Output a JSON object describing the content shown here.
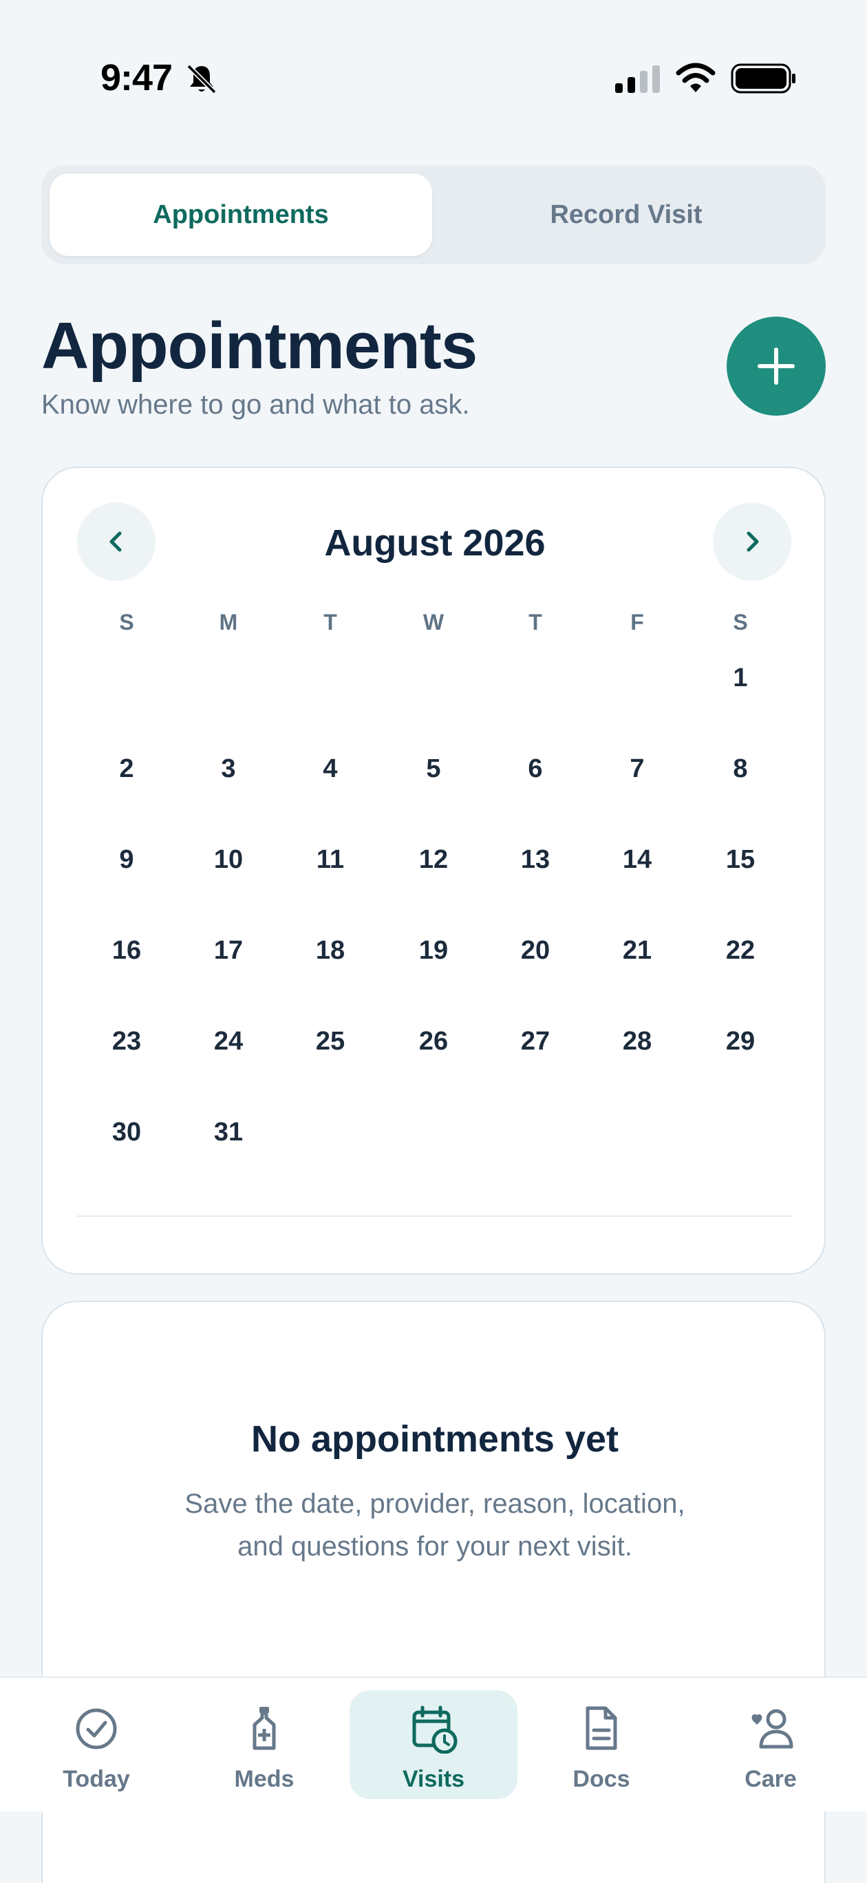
{
  "status_bar": {
    "time": "9:47"
  },
  "segmented": {
    "active_label": "Appointments",
    "inactive_label": "Record Visit"
  },
  "header": {
    "title": "Appointments",
    "subtitle": "Know where to go and what to ask."
  },
  "calendar": {
    "month_label": "August 2026",
    "prev_icon": "chevron-left-icon",
    "next_icon": "chevron-right-icon",
    "weekdays": [
      "S",
      "M",
      "T",
      "W",
      "T",
      "F",
      "S"
    ],
    "first_weekday_index": 6,
    "days": [
      "1",
      "2",
      "3",
      "4",
      "5",
      "6",
      "7",
      "8",
      "9",
      "10",
      "11",
      "12",
      "13",
      "14",
      "15",
      "16",
      "17",
      "18",
      "19",
      "20",
      "21",
      "22",
      "23",
      "24",
      "25",
      "26",
      "27",
      "28",
      "29",
      "30",
      "31"
    ]
  },
  "empty_state": {
    "title": "No appointments yet",
    "desc_line1": "Save the date, provider, reason, location,",
    "desc_line2": "and questions for your next visit."
  },
  "tab_bar": {
    "tabs": [
      {
        "label": "Today",
        "icon": "check-circle-icon"
      },
      {
        "label": "Meds",
        "icon": "medicine-bottle-icon"
      },
      {
        "label": "Visits",
        "icon": "calendar-clock-icon"
      },
      {
        "label": "Docs",
        "icon": "document-icon"
      },
      {
        "label": "Care",
        "icon": "caregiver-icon"
      }
    ],
    "active_index": 2
  },
  "colors": {
    "accent": "#1f8e7f",
    "accent_dark": "#0e6a5e",
    "active_tab_bg": "#e2f1f2",
    "background": "#f2f6f9"
  }
}
